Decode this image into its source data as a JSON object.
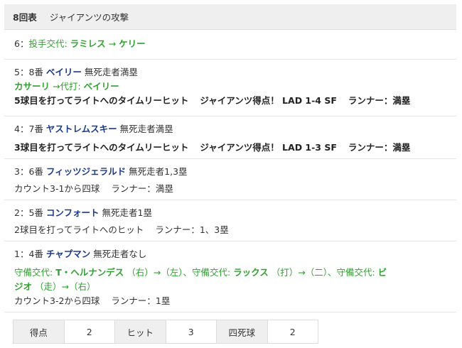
{
  "header": {
    "inning": "8回表",
    "team_attack": "ジャイアンツの攻撃"
  },
  "plays": [
    {
      "number": "6",
      "pitcher_change_label": "投手交代:",
      "from": "ラミレス",
      "arrow": "→",
      "to": "ケリー"
    },
    {
      "number": "5",
      "batter_order": "8番",
      "batter": "ベイリー",
      "situation": "無死走者満塁",
      "sub_out": "カサーリ",
      "sub_label": "→代打:",
      "sub_in": "ベイリー",
      "result": "5球目を打ってライトへのタイムリーヒット",
      "score_text": "ジャイアンツ得点！ LAD 1-4 SF",
      "runner": "ランナー：満塁"
    },
    {
      "number": "4",
      "batter_order": "7番",
      "batter": "ヤストレムスキー",
      "situation": "無死走者満塁",
      "result": "3球目を打ってライトへのタイムリーヒット",
      "score_text": "ジャイアンツ得点！ LAD 1-3 SF",
      "runner": "ランナー：満塁"
    },
    {
      "number": "3",
      "batter_order": "6番",
      "batter": "フィッツジェラルド",
      "situation": "無死走者1,3塁",
      "result": "カウント3-1から四球",
      "runner": "ランナー：満塁"
    },
    {
      "number": "2",
      "batter_order": "5番",
      "batter": "コンフォート",
      "situation": "無死走者1塁",
      "result": "2球目を打ってライトへのヒット",
      "runner": "ランナー：1、3塁"
    },
    {
      "number": "1",
      "batter_order": "4番",
      "batter": "チャプマン",
      "situation": "無死走者なし",
      "def_label_1": "守備交代:",
      "def_player_1": "T・ヘルナンデス",
      "def_pos_1": "（右）→（左）、",
      "def_label_2": "守備交代:",
      "def_player_2": "ラックス",
      "def_pos_2": "（打）→（二）、",
      "def_label_3": "守備交代:",
      "def_player_3_a": "ビ",
      "def_player_3_b": "ジオ",
      "def_pos_3": "（走）→（右）",
      "result": "カウント3-2から四球",
      "runner": "ランナー：1塁"
    }
  ],
  "stats": {
    "runs_label": "得点",
    "runs": "2",
    "hits_label": "ヒット",
    "hits": "3",
    "walks_label": "四死球",
    "walks": "2"
  }
}
